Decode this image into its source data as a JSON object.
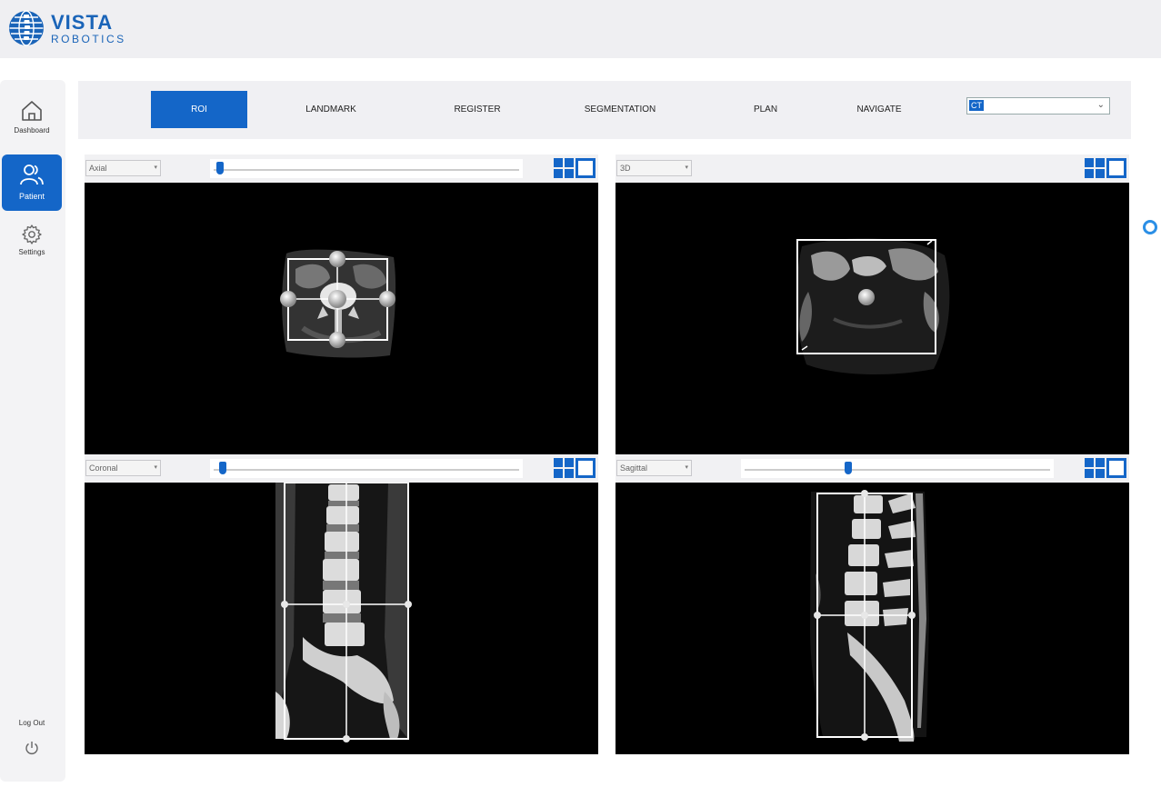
{
  "brand": {
    "name_line1": "VISTA",
    "name_line2": "ROBOTICS",
    "color": "#1a64b8"
  },
  "sidebar": {
    "items": [
      {
        "label": "Dashboard",
        "icon": "home-icon",
        "active": false
      },
      {
        "label": "Patient",
        "icon": "user-group-icon",
        "active": true
      },
      {
        "label": "Settings",
        "icon": "gear-icon",
        "active": false
      }
    ],
    "logout": {
      "label": "Log Out",
      "icon": "power-icon"
    }
  },
  "tabs": [
    {
      "label": "ROI",
      "active": true
    },
    {
      "label": "LANDMARK",
      "active": false
    },
    {
      "label": "REGISTER",
      "active": false
    },
    {
      "label": "SEGMENTATION",
      "active": false
    },
    {
      "label": "PLAN",
      "active": false
    },
    {
      "label": "NAVIGATE",
      "active": false
    }
  ],
  "modality_select": {
    "value": "CT"
  },
  "viewports": [
    {
      "view": "Axial",
      "slider": 0.02
    },
    {
      "view": "3D",
      "slider": null
    },
    {
      "view": "Coronal",
      "slider": 0.03
    },
    {
      "view": "Sagittal",
      "slider": 0.34
    }
  ],
  "colors": {
    "accent": "#1466c8",
    "indicator": "#2b8fe6"
  }
}
